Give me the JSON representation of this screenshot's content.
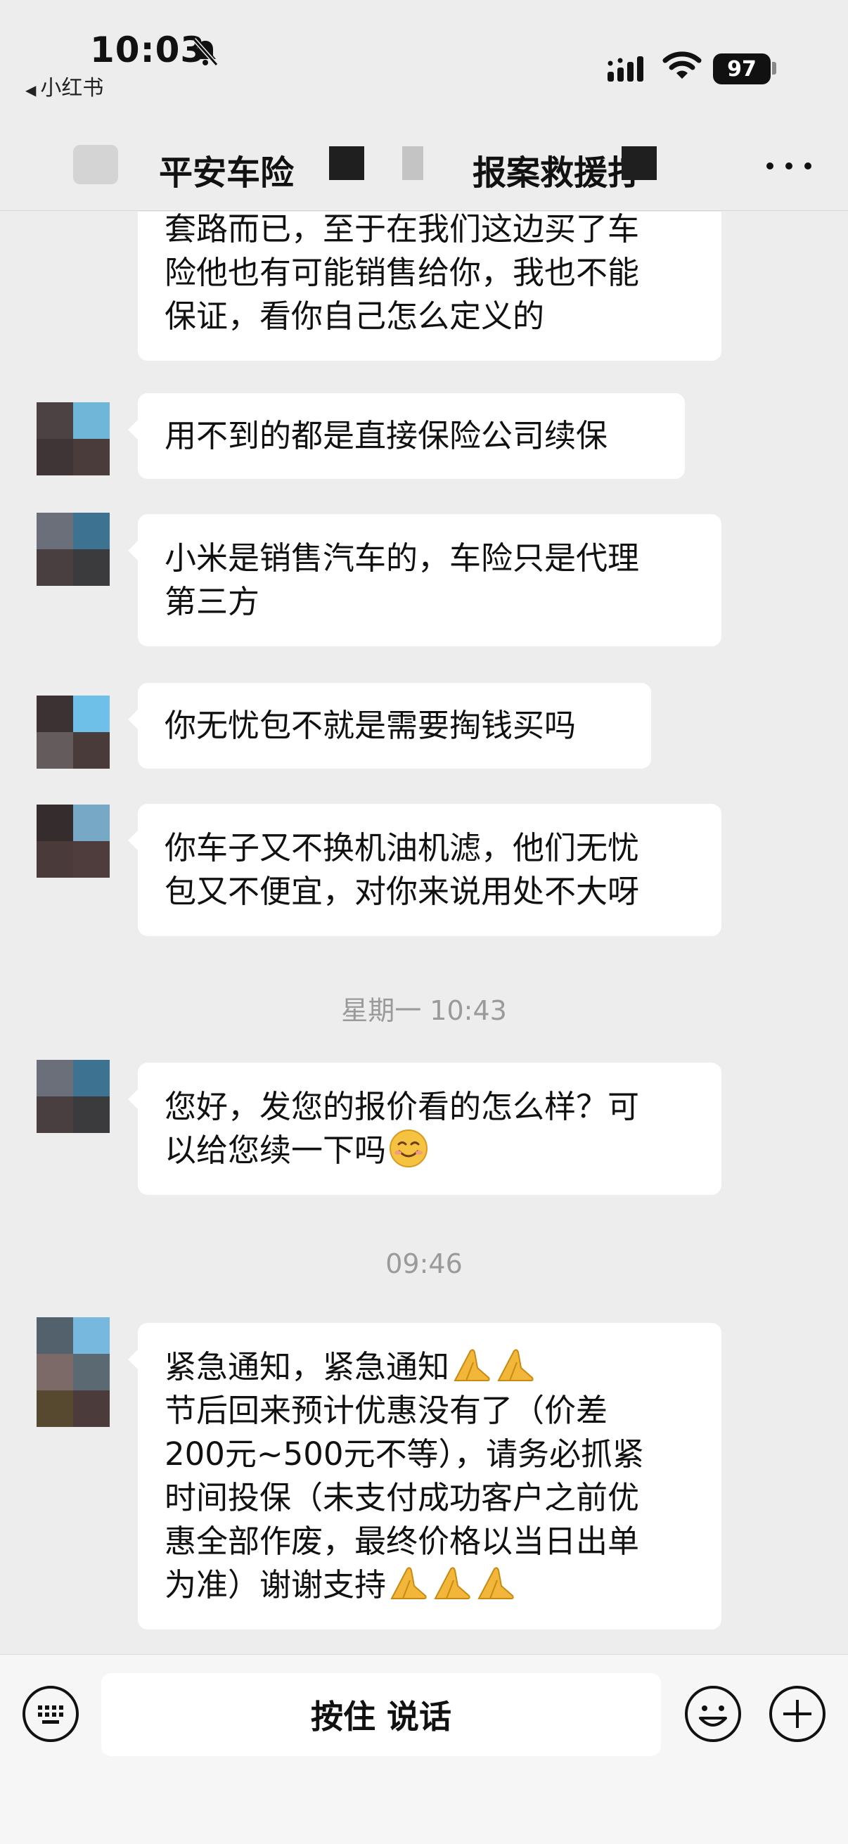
{
  "status_bar": {
    "time": "10:03",
    "back_app": "小红书",
    "battery": "97"
  },
  "nav": {
    "title": "平安车险",
    "title_2": "报案救援打"
  },
  "messages": [
    {
      "id": "m0",
      "text": "套路而已，至于在我们这边买了车\n险他也有可能销售给你，我也不能\n保证，看你自己怎么定义的"
    },
    {
      "id": "m1",
      "text": "用不到的都是直接保险公司续保"
    },
    {
      "id": "m2",
      "text": "小米是销售汽车的，车险只是代理\n第三方"
    },
    {
      "id": "m3",
      "text": "你无忧包不就是需要掏钱买吗"
    },
    {
      "id": "m4",
      "text": "你车子又不换机油机滤，他们无忧\n包又不便宜，对你来说用处不大呀"
    },
    {
      "id": "m5",
      "text": "您好，发您的报价看的怎么样？可\n以给您续一下吗"
    },
    {
      "id": "m6",
      "line1": "紧急通知，紧急通知",
      "text": "节后回来预计优惠没有了（价差\n200元~500元不等），请务必抓紧\n时间投保（未支付成功客户之前优\n惠全部作废，最终价格以当日出单\n为准）谢谢支持"
    }
  ],
  "timestamps": [
    "星期一 10:43",
    "09:46"
  ],
  "input_bar": {
    "hold_to_talk": "按住 说话"
  },
  "icons": {
    "bell_slash": "bell-slash-icon",
    "keyboard": "keyboard-icon",
    "emoji": "emoji-icon",
    "plus": "plus-circle-icon",
    "more": "more-icon",
    "smile_emoji": "smiling-face-emoji",
    "pray_emoji": "folded-hands-emoji"
  },
  "colors": {
    "chat_background": "#ededed",
    "bubble": "#ffffff",
    "timestamp_text": "#9a9a9a",
    "emoji_yellow": "#f2b63a"
  }
}
